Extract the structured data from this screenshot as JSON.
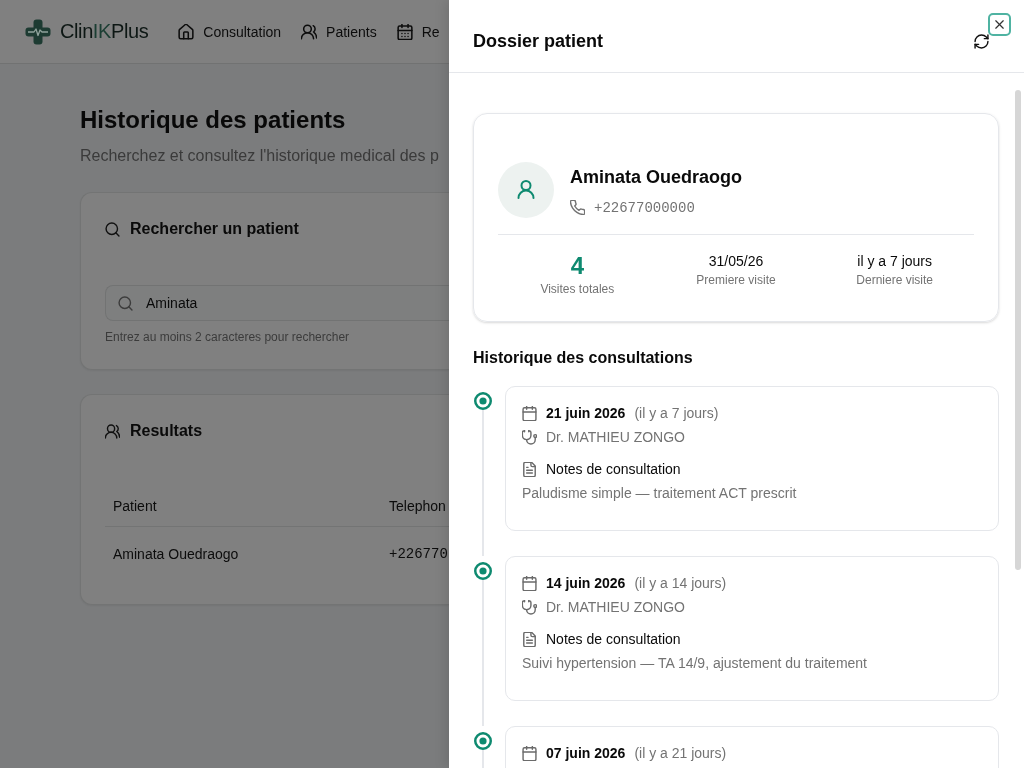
{
  "header": {
    "logo": "Clin**IK**Plus",
    "nav": [
      {
        "label": "Consultation"
      },
      {
        "label": "Patients"
      },
      {
        "label": "Re"
      }
    ]
  },
  "page": {
    "title": "Historique des patients",
    "subtitle": "Recherchez et consultez l'historique medical des p"
  },
  "search_card": {
    "title": "Rechercher un patient",
    "field": {
      "value": "Aminata"
    },
    "hint": "Entrez au moins 2 caracteres pour rechercher"
  },
  "results_card": {
    "title": "Resultats",
    "table": {
      "columns": [
        "Patient",
        "Telephon"
      ],
      "rows": [
        [
          "Aminata Ouedraogo",
          "+226770"
        ]
      ]
    }
  },
  "drawer": {
    "title": "Dossier patient",
    "close_button": {
      "focused": true
    },
    "patient": {
      "name": "Aminata Ouedraogo",
      "phone": "+22677000000"
    },
    "stats": [
      {
        "kind": "count",
        "value": "4",
        "label": "Visites totales"
      },
      {
        "kind": "text",
        "value": "31/05/26",
        "label": "Premiere visite"
      },
      {
        "kind": "text",
        "value": "il y a 7 jours",
        "label": "Derniere visite"
      }
    ],
    "history_title": "Historique des consultations",
    "consultations": [
      {
        "date": "21 juin 2026",
        "relative": "(il y a 7 jours)",
        "doctor": "Dr. MATHIEU ZONGO",
        "notes_title": "Notes de consultation",
        "notes": "Paludisme simple — traitement ACT prescrit"
      },
      {
        "date": "14 juin 2026",
        "relative": "(il y a 14 jours)",
        "doctor": "Dr. MATHIEU ZONGO",
        "notes_title": "Notes de consultation",
        "notes": "Suivi hypertension — TA 14/9, ajustement du traitement"
      },
      {
        "date": "07 juin 2026",
        "relative": "(il y a 21 jours)"
      }
    ]
  }
}
